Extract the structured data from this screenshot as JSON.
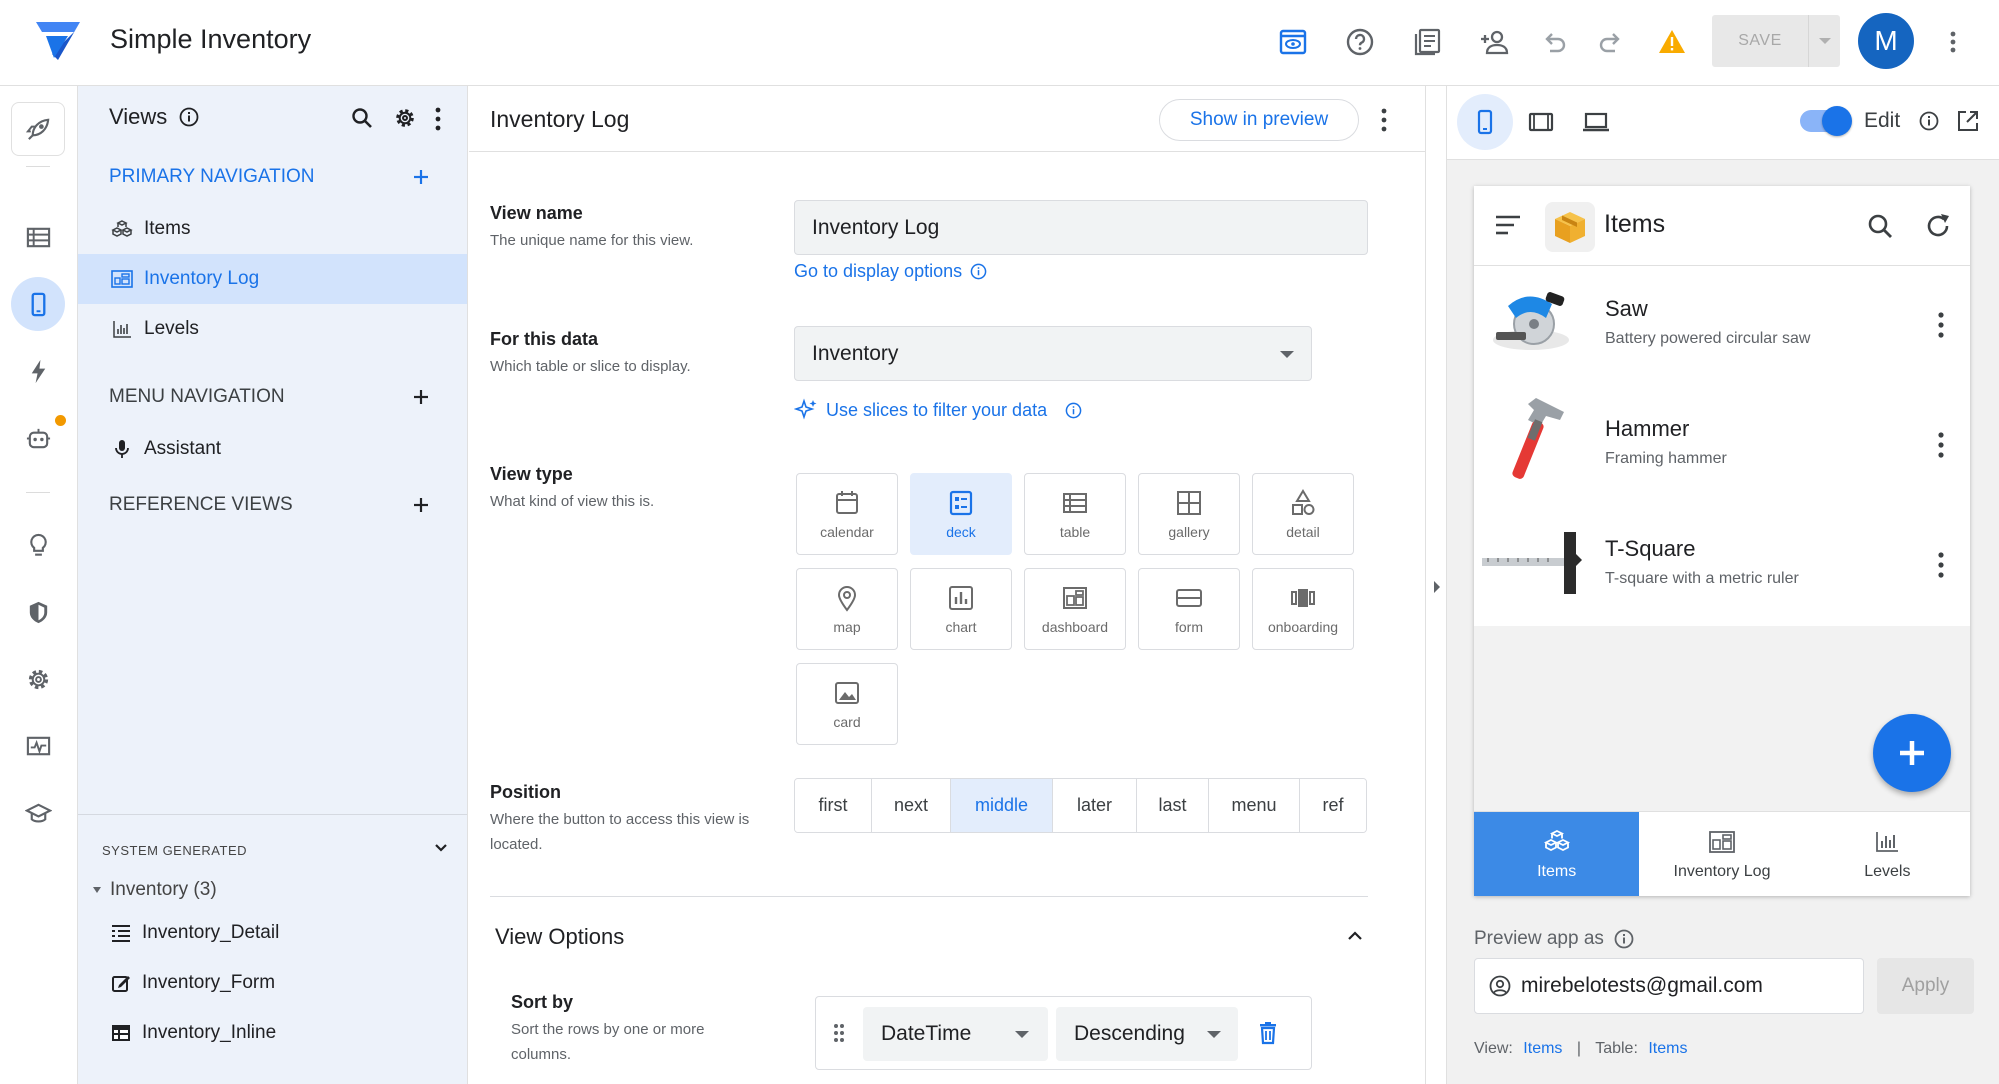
{
  "app": {
    "title": "Simple Inventory",
    "avatar_letter": "M",
    "save_label": "SAVE"
  },
  "topbar_icons": [
    "preview-eye-icon",
    "help-icon",
    "docs-icon",
    "share-user-icon",
    "undo-icon",
    "redo-icon",
    "warning-icon",
    "more-vert-icon"
  ],
  "rail_icons": [
    "rocket-icon",
    "data-icon",
    "app-phone-icon",
    "automation-bolt-icon",
    "bot-icon",
    "lightbulb-icon",
    "security-shield-icon",
    "settings-gear-icon",
    "monitor-icon",
    "learn-cap-icon"
  ],
  "views_panel": {
    "title": "Views",
    "primary_header": "PRIMARY NAVIGATION",
    "primary_items": [
      {
        "label": "Items",
        "icon": "deck-icon"
      },
      {
        "label": "Inventory Log",
        "icon": "dashboard-icon"
      },
      {
        "label": "Levels",
        "icon": "chart-icon"
      }
    ],
    "menu_header": "MENU NAVIGATION",
    "menu_items": [
      {
        "label": "Assistant",
        "icon": "mic-icon"
      }
    ],
    "reference_header": "REFERENCE VIEWS",
    "system_title": "SYSTEM GENERATED",
    "system_group": "Inventory (3)",
    "system_items": [
      {
        "label": "Inventory_Detail",
        "icon": "detail-icon"
      },
      {
        "label": "Inventory_Form",
        "icon": "form-edit-icon"
      },
      {
        "label": "Inventory_Inline",
        "icon": "table-icon"
      }
    ]
  },
  "editor": {
    "title": "Inventory Log",
    "show_in_preview": "Show in preview",
    "view_name": {
      "label": "View name",
      "help": "The unique name for this view.",
      "value": "Inventory Log",
      "link": "Go to display options"
    },
    "for_data": {
      "label": "For this data",
      "help": "Which table or slice to display.",
      "value": "Inventory",
      "link": "Use slices to filter your data"
    },
    "view_type": {
      "label": "View type",
      "help": "What kind of view this is.",
      "options": [
        "calendar",
        "deck",
        "table",
        "gallery",
        "detail",
        "map",
        "chart",
        "dashboard",
        "form",
        "onboarding",
        "card"
      ],
      "selected": "deck"
    },
    "position": {
      "label": "Position",
      "help": "Where the button to access this view is located.",
      "options": [
        "first",
        "next",
        "middle",
        "later",
        "last",
        "menu",
        "ref"
      ],
      "selected": "middle"
    },
    "view_options_title": "View Options",
    "sort_by": {
      "label": "Sort by",
      "help": "Sort the rows by one or more columns.",
      "column": "DateTime",
      "order": "Descending"
    }
  },
  "preview": {
    "edit_label": "Edit",
    "app_title": "Items",
    "items": [
      {
        "title": "Saw",
        "subtitle": "Battery powered circular saw"
      },
      {
        "title": "Hammer",
        "subtitle": "Framing hammer"
      },
      {
        "title": "T-Square",
        "subtitle": "T-square with a metric ruler"
      }
    ],
    "bottom_nav": [
      {
        "label": "Items",
        "active": true
      },
      {
        "label": "Inventory Log",
        "active": false
      },
      {
        "label": "Levels",
        "active": false
      }
    ],
    "preview_as_label": "Preview app as",
    "email": "mirebelotests@gmail.com",
    "apply_label": "Apply",
    "footer": {
      "view_label": "View:",
      "view_value": "Items",
      "sep": "|",
      "table_label": "Table:",
      "table_value": "Items"
    }
  },
  "colors": {
    "accent": "#1a73e8",
    "panel_bg": "#edf2fa",
    "selected_bg": "#d2e3fc",
    "warning": "#f9ab00",
    "notify_dot": "#f29900"
  }
}
